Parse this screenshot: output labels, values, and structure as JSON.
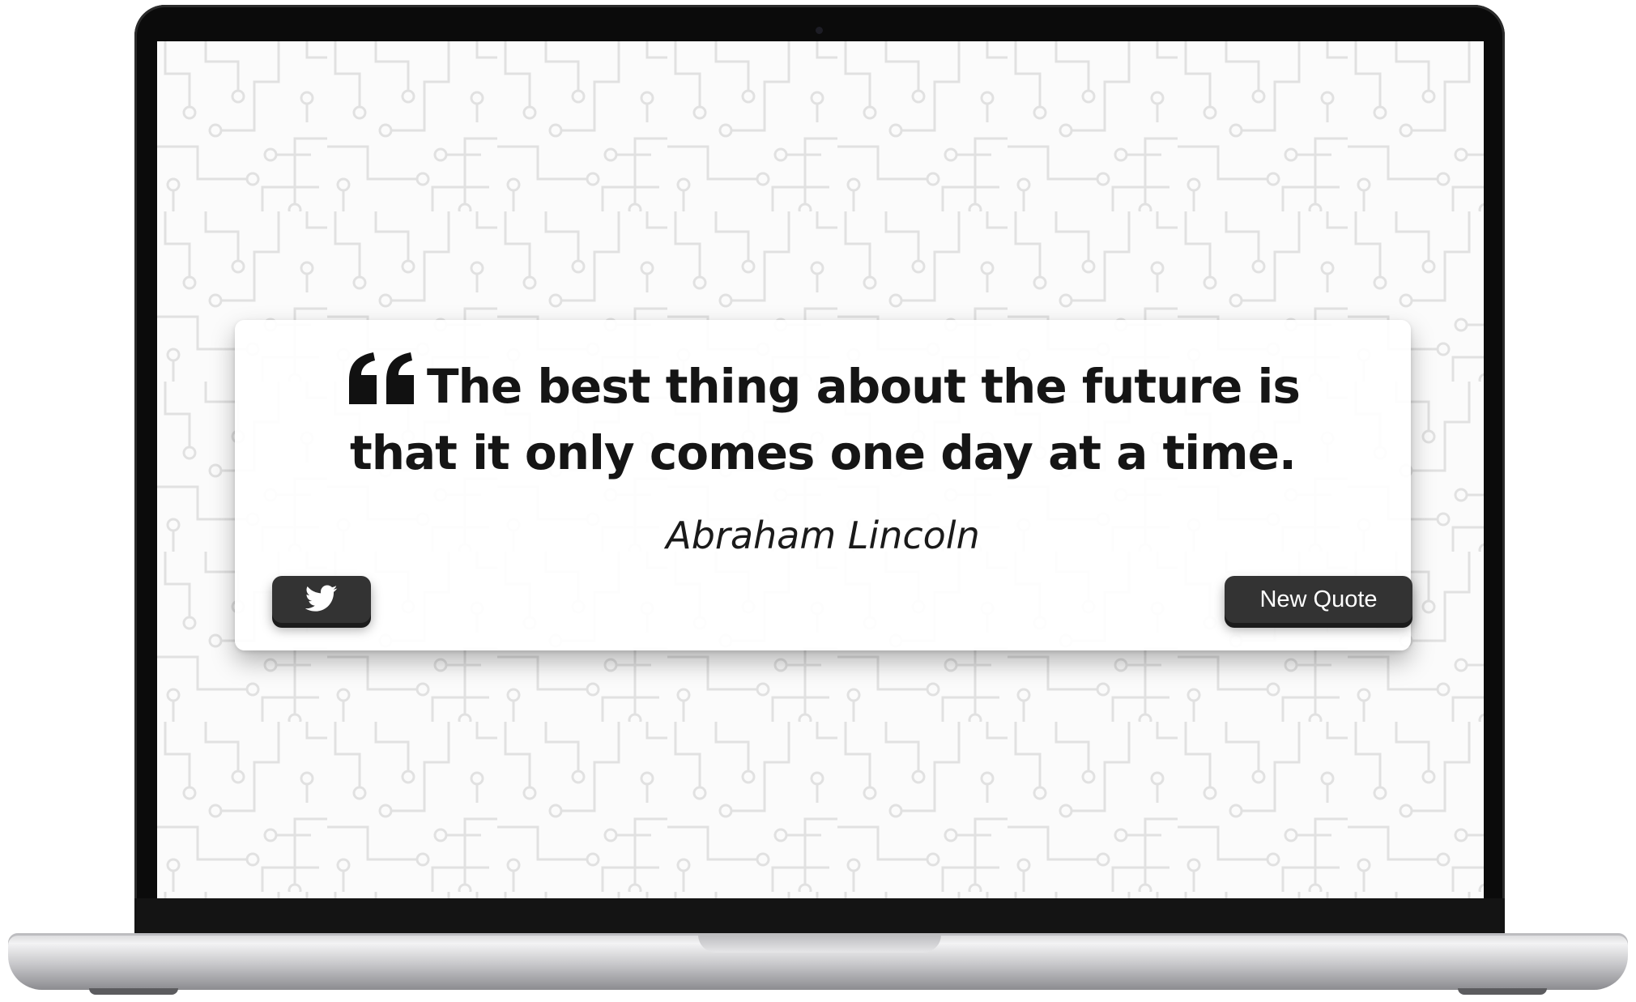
{
  "quote": {
    "text": "The best thing about the future is that it only comes one day at a time.",
    "author": "Abraham Lincoln",
    "icon": "quote-left-icon"
  },
  "actions": {
    "tweet_icon": "twitter-icon",
    "new_quote_label": "New Quote"
  },
  "colors": {
    "button_bg": "#333333",
    "button_text": "#ffffff",
    "text": "#151515",
    "screen_bg": "#fbfbfb",
    "pattern": "#e2e2e2"
  }
}
